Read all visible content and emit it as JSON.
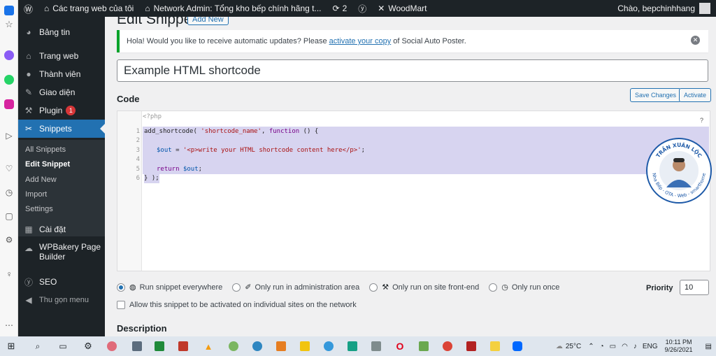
{
  "adminbar": {
    "my_sites": "Các trang web của tôi",
    "network_admin": "Network Admin: Tổng kho bếp chính hãng t...",
    "updates_count": "2",
    "woodmart": "WoodMart",
    "greeting": "Chào, bepchinhhang"
  },
  "menu": {
    "dashboard": "Bảng tin",
    "sites": "Trang web",
    "users": "Thành viên",
    "themes": "Giao diện",
    "plugins": "Plugin",
    "plugins_badge": "1",
    "snippets": "Snippets",
    "sub": [
      "All Snippets",
      "Edit Snippet",
      "Add New",
      "Import",
      "Settings"
    ],
    "settings": "Cài đặt",
    "wpbakery_line1": "WPBakery Page",
    "wpbakery_line2": "Builder",
    "seo": "SEO",
    "collapse": "Thu gọn menu"
  },
  "page": {
    "title": "Edit Snippet",
    "add_new": "Add New",
    "notice_pre": "Hola! Would you like to receive automatic updates? Please",
    "notice_link": "activate your copy",
    "notice_post": "of Social Auto Poster.",
    "snippet_title": "Example HTML shortcode",
    "code_heading": "Code",
    "save_changes": "Save Changes",
    "activate": "Activate",
    "php_open": "<?php",
    "help": "?",
    "lines": {
      "l1_fn": "add_shortcode( ",
      "l1_str": "'shortcode_name'",
      "l1_mid": ", ",
      "l1_kw": "function",
      "l1_end": " () {",
      "l3_var": "$out",
      "l3_eq": " = ",
      "l3_str": "'<p>write your HTML shortcode content here</p>'",
      "l3_end": ";",
      "l5_kw": "return",
      "l5_var": "$out",
      "l5_end": ";",
      "l6": "} );"
    },
    "line_numbers": [
      "1",
      "2",
      "3",
      "4",
      "5",
      "6"
    ],
    "scope_options": [
      "Run snippet everywhere",
      "Only run in administration area",
      "Only run on site front-end",
      "Only run once"
    ],
    "priority_label": "Priority",
    "priority_value": "10",
    "network_checkbox": "Allow this snippet to be activated on individual sites on the network",
    "description_heading": "Description"
  },
  "watermark": {
    "name": "TRẦN XUÂN LỘC",
    "tagline": "Nha Bếp - OTA - Web - smarthome"
  },
  "taskbar": {
    "weather": "25°C",
    "lang": "ENG",
    "time": "10:11 PM",
    "date": "9/26/2021"
  },
  "colors": {
    "admin_dark": "#1d2327",
    "admin_blue": "#2271b1",
    "selection": "#d7d4f0",
    "notice_green": "#00a32a"
  }
}
